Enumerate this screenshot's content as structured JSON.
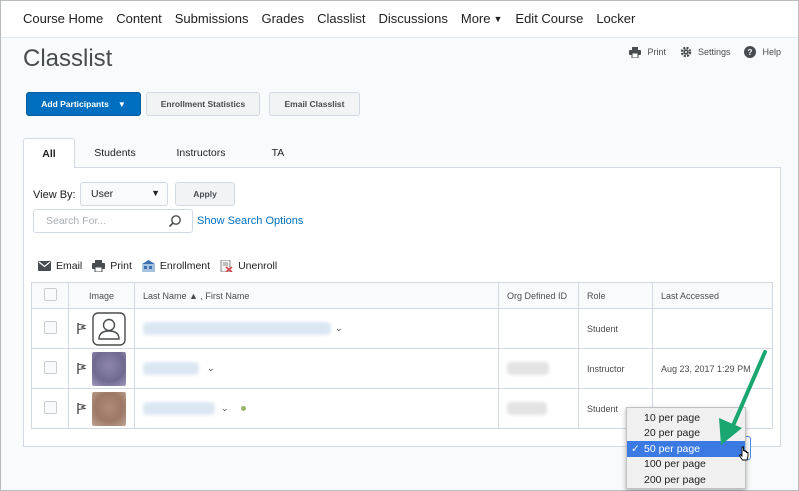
{
  "nav": {
    "items": [
      "Course Home",
      "Content",
      "Submissions",
      "Grades",
      "Classlist",
      "Discussions",
      "More",
      "Edit Course",
      "Locker"
    ]
  },
  "page": {
    "title": "Classlist"
  },
  "toplinks": {
    "print": "Print",
    "settings": "Settings",
    "help": "Help"
  },
  "buttons": {
    "add_participants": "Add Participants",
    "enrollment_statistics": "Enrollment Statistics",
    "email_classlist": "Email Classlist",
    "apply": "Apply"
  },
  "tabs": [
    "All",
    "Students",
    "Instructors",
    "TA"
  ],
  "filters": {
    "view_by_label": "View By:",
    "view_by_value": "User",
    "search_placeholder": "Search For...",
    "show_search_options": "Show Search Options"
  },
  "actions": {
    "email": "Email",
    "print": "Print",
    "enrollment": "Enrollment",
    "unenroll": "Unenroll"
  },
  "table": {
    "headers": {
      "image": "Image",
      "name": "Last Name ▲ , First Name",
      "org_id": "Org Defined ID",
      "role": "Role",
      "last_accessed": "Last Accessed"
    },
    "rows": [
      {
        "role": "Student",
        "last_accessed": ""
      },
      {
        "role": "Instructor",
        "last_accessed": "Aug 23, 2017 1:29 PM"
      },
      {
        "role": "Student",
        "last_accessed": ""
      }
    ]
  },
  "per_page": {
    "options": [
      "10 per page",
      "20 per page",
      "50 per page",
      "100 per page",
      "200 per page"
    ],
    "selected": "50 per page",
    "check": "✓"
  },
  "colors": {
    "primary": "#006fbf",
    "highlight": "#3b7ae3",
    "arrow": "#1aa66f"
  },
  "icons": [
    "print-icon",
    "gear-icon",
    "help-icon",
    "chevron-down-icon",
    "search-icon",
    "email-icon",
    "enrollment-icon",
    "unenroll-icon",
    "flag-icon",
    "user-placeholder-icon",
    "arrow-annotation"
  ]
}
